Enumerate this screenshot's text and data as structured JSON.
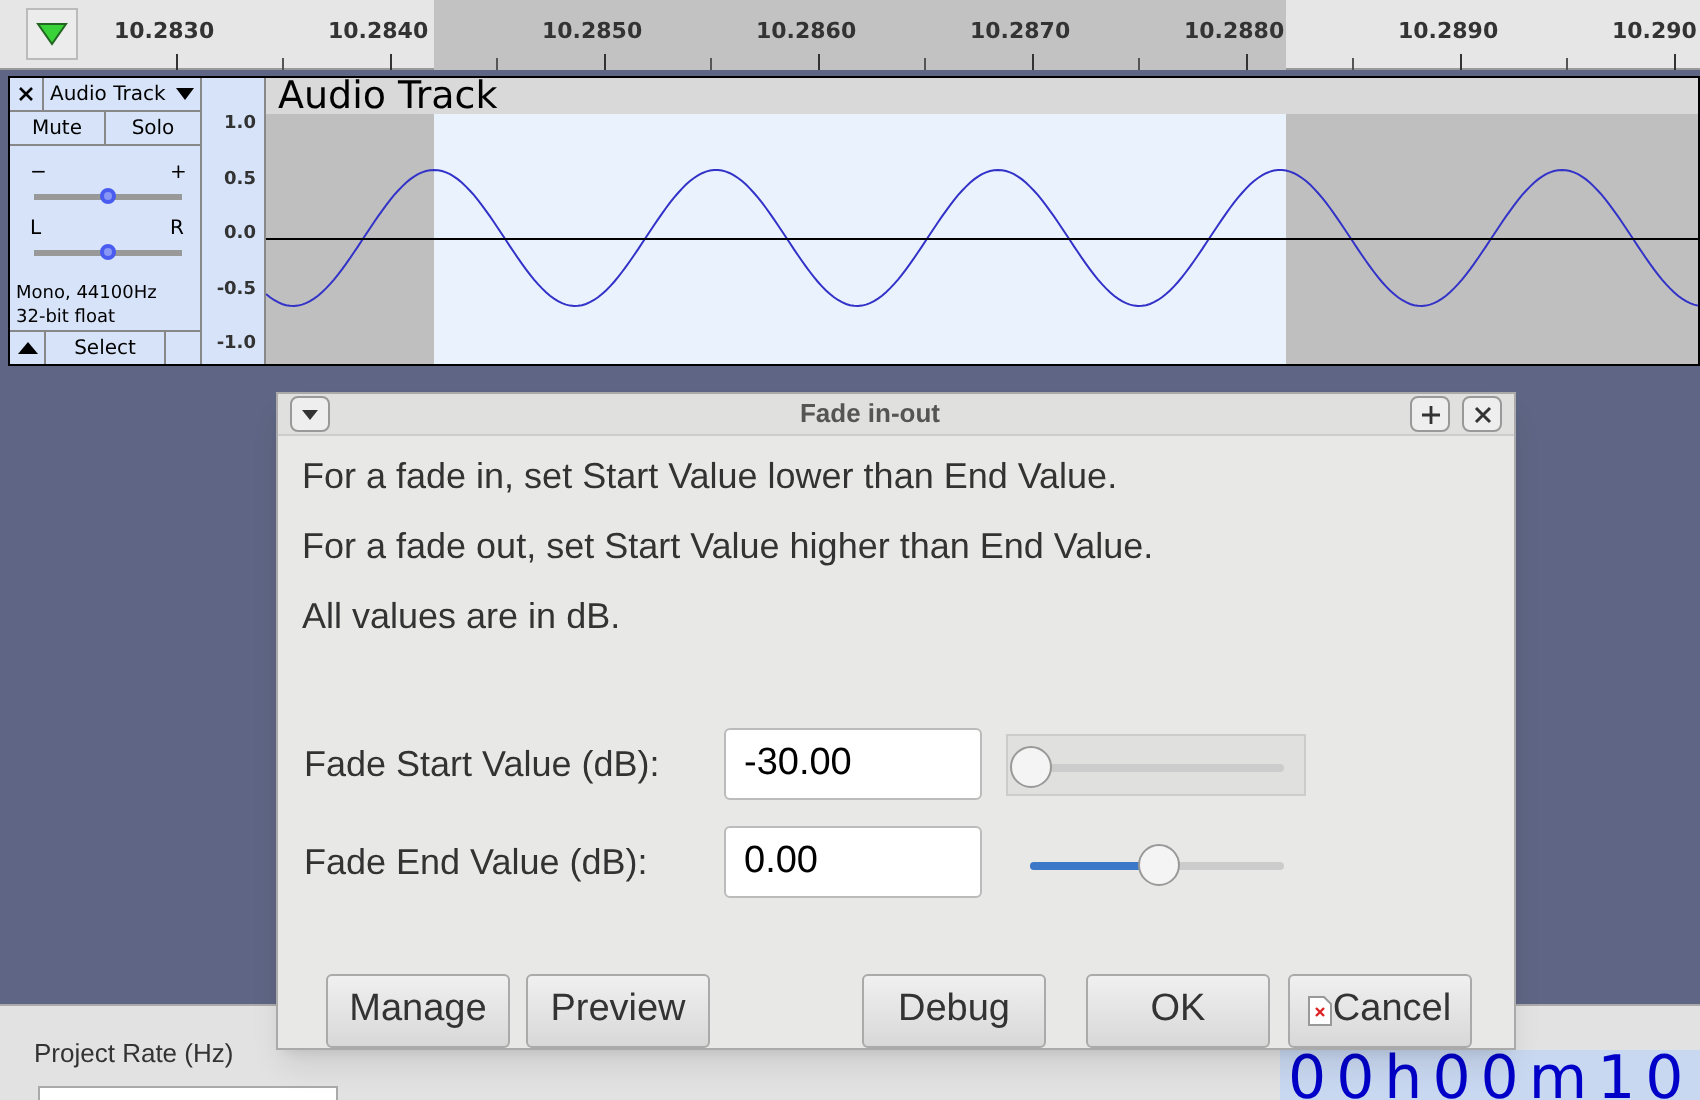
{
  "ruler": {
    "ticks": [
      "10.2830",
      "10.2840",
      "10.2850",
      "10.2860",
      "10.2870",
      "10.2880",
      "10.2890",
      "10.290"
    ]
  },
  "track": {
    "menu_label": "Audio Track",
    "title": "Audio Track",
    "buttons": [
      "Mute",
      "Solo"
    ],
    "gain": {
      "min_label": "−",
      "max_label": "+",
      "level": 0.5
    },
    "pan": {
      "left_label": "L",
      "right_label": "R",
      "level": 0.5
    },
    "info": [
      "Mono, 44100Hz",
      "32-bit float"
    ],
    "select_button": "Select",
    "scale": [
      "1.0",
      "0.5",
      "0.0",
      "-0.5",
      "-1.0"
    ]
  },
  "dialog": {
    "title": "Fade in-out",
    "lines": [
      "For a fade in, set Start Value lower than End Value.",
      "For a fade out, set Start Value higher than End Value.",
      "All values are in dB."
    ],
    "fields": [
      {
        "label": "Fade Start Value (dB):",
        "value": "-30.00",
        "level": 0,
        "focused": true
      },
      {
        "label": "Fade End Value (dB):",
        "value": "0.00",
        "level": 0.5,
        "focused": false
      }
    ],
    "buttons": [
      {
        "label": "Manage",
        "kind": "plain"
      },
      {
        "label": "Preview",
        "kind": "plain"
      },
      {
        "label": "Debug",
        "kind": "plain"
      },
      {
        "label": "OK",
        "kind": "plain"
      },
      {
        "label": "Cancel",
        "kind": "icon"
      }
    ]
  },
  "toolbar": {
    "project_rate_label": "Project Rate (Hz)",
    "time": "00h00m10"
  }
}
